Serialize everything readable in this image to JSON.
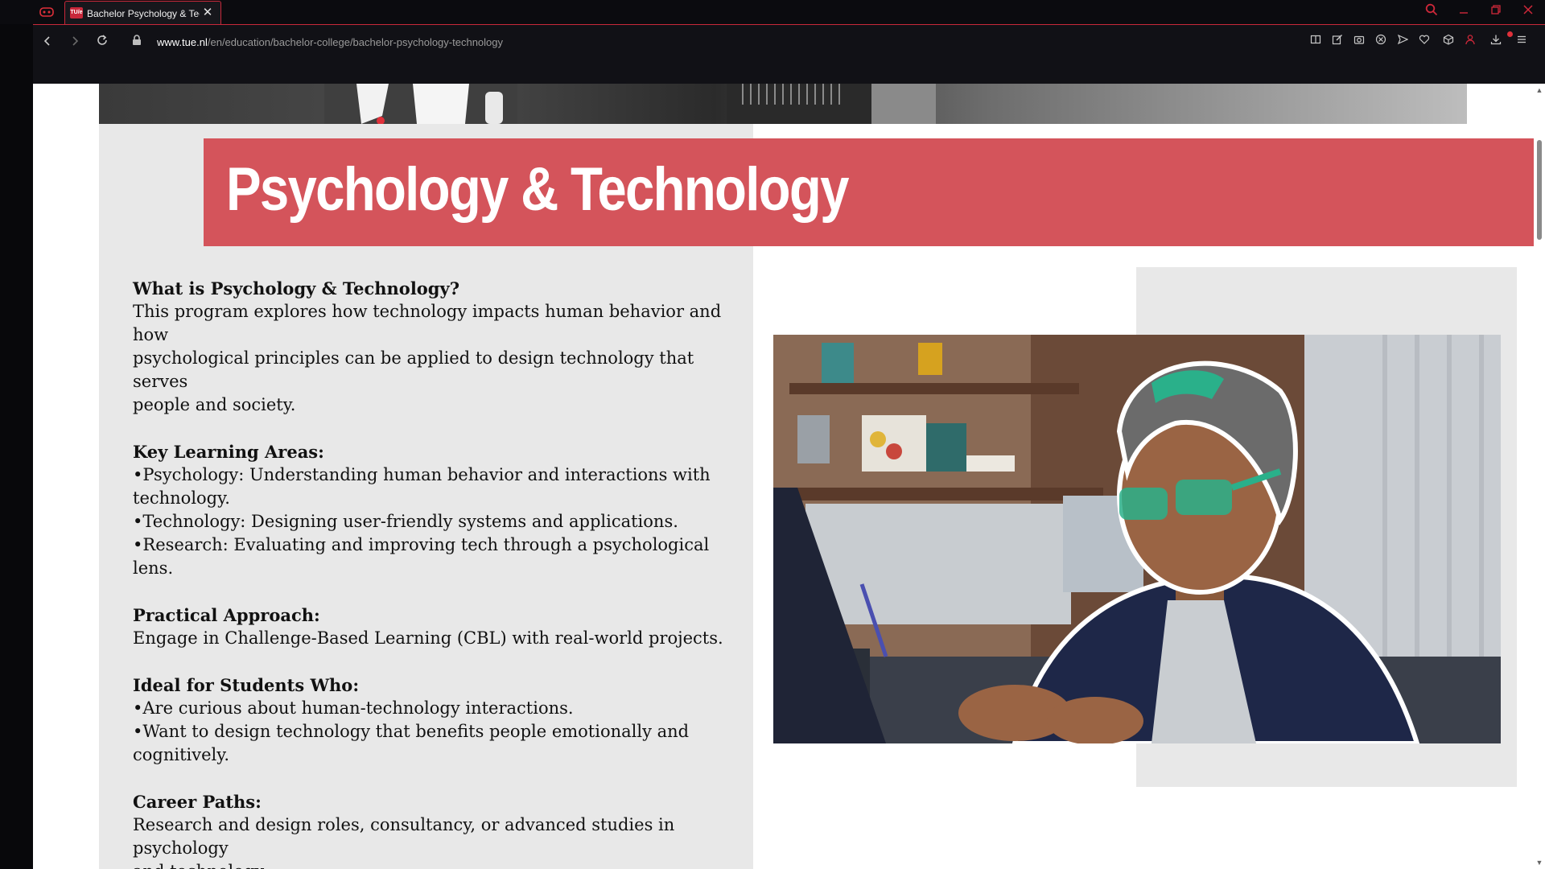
{
  "browser": {
    "tab_title": "Bachelor Psychology & Tec",
    "favicon_text": "TU/e",
    "url_host": "www.tue.nl",
    "url_path": "/en/education/bachelor-college/bachelor-psychology-technology",
    "accent_color": "#d0283a"
  },
  "icons": [
    "gx-controls-icon",
    "search-icon",
    "minimize-icon",
    "restore-icon",
    "close-icon",
    "back-icon",
    "forward-icon",
    "reload-icon",
    "lock-icon",
    "reader-icon",
    "edit-icon",
    "snapshot-icon",
    "adblock-icon",
    "send-icon",
    "heart-icon",
    "cube-icon",
    "profile-icon",
    "download-icon",
    "menu-icon"
  ],
  "page": {
    "title": "Psychology & Technology",
    "banner_color": "#d4545b",
    "sections": [
      {
        "heading": "What is Psychology & Technology?",
        "lines": [
          "This program explores how technology impacts human behavior and how",
          "psychological principles can be applied to design technology that serves",
          "people and society."
        ]
      },
      {
        "heading": "Key Learning Areas:",
        "lines": [
          "•Psychology: Understanding human behavior and interactions with",
          "technology.",
          "•Technology: Designing user-friendly systems and applications.",
          "•Research: Evaluating and improving tech through a psychological lens."
        ]
      },
      {
        "heading": "Practical Approach:",
        "lines": [
          "Engage in Challenge-Based Learning (CBL) with real-world projects."
        ]
      },
      {
        "heading": "Ideal for Students Who:",
        "lines": [
          "•Are curious about human-technology interactions.",
          "•Want to design technology that benefits people emotionally and",
          "cognitively."
        ]
      },
      {
        "heading": "Career Paths:",
        "lines": [
          "Research and design roles, consultancy, or advanced studies in psychology",
          "and technology."
        ]
      }
    ]
  }
}
